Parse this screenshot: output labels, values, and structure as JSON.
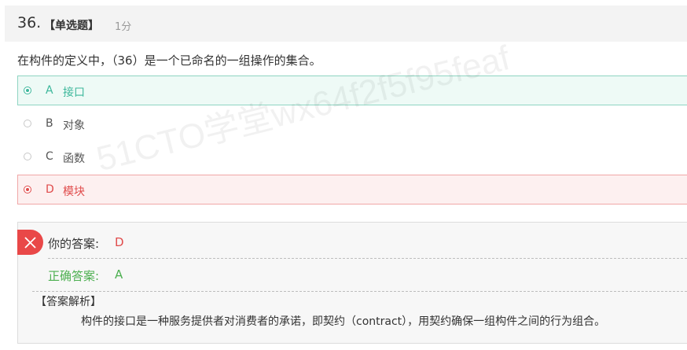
{
  "question": {
    "number": "36.",
    "type": "【单选题】",
    "score": "1分",
    "text": "在构件的定义中，（36）是一个已命名的一组操作的集合。"
  },
  "options": [
    {
      "letter": "A",
      "text": "接口",
      "state": "correct-selected"
    },
    {
      "letter": "B",
      "text": "对象",
      "state": "none"
    },
    {
      "letter": "C",
      "text": "函数",
      "state": "none"
    },
    {
      "letter": "D",
      "text": "模块",
      "state": "wrong-selected"
    }
  ],
  "result": {
    "your_answer_label": "你的答案:",
    "your_answer": "D",
    "correct_answer_label": "正确答案:",
    "correct_answer": "A",
    "analysis_title": "【答案解析】",
    "analysis_text": "构件的接口是一种服务提供者对消费者的承诺，即契约（contract），用契约确保一组构件之间的行为组合。"
  },
  "watermark": "51CTO学堂wx64f2f5f95feaf",
  "colors": {
    "correct": "#3cb79b",
    "wrong": "#e04b4b",
    "correct_text": "#4caf50"
  },
  "icons": {
    "wrong_badge": "close-icon"
  }
}
